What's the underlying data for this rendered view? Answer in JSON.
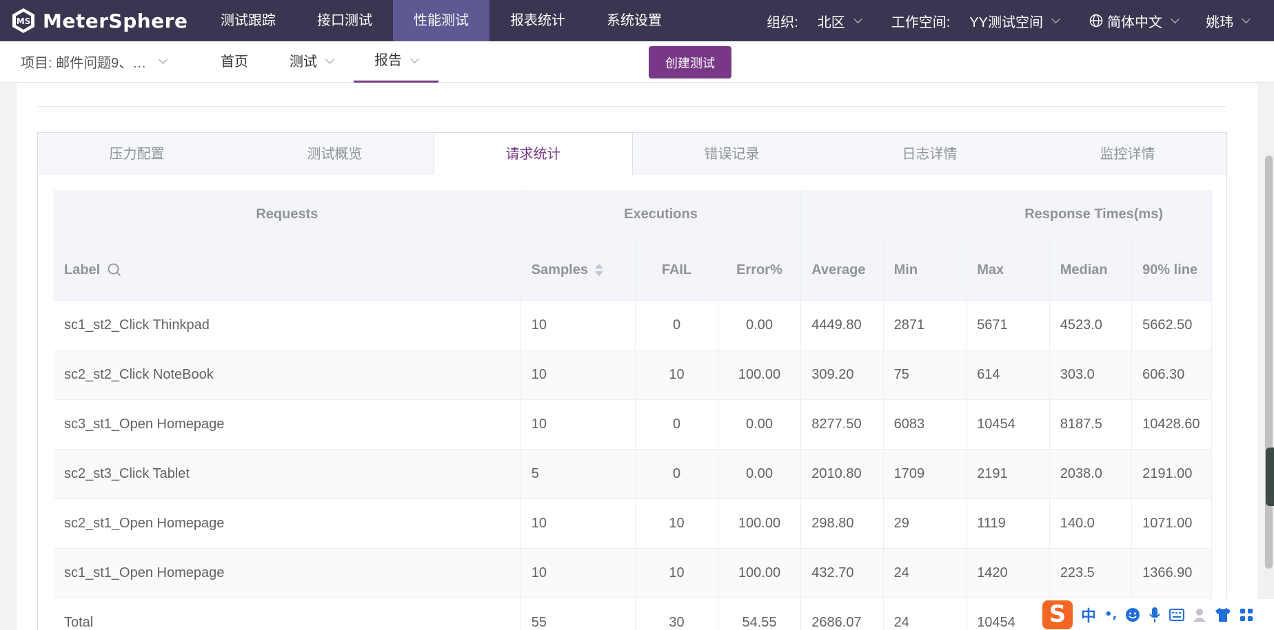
{
  "app": {
    "logo_text": "MeterSphere"
  },
  "topnav": {
    "items": [
      {
        "label": "测试跟踪"
      },
      {
        "label": "接口测试"
      },
      {
        "label": "性能测试"
      },
      {
        "label": "报表统计"
      },
      {
        "label": "系统设置"
      }
    ],
    "active_index": 2,
    "org_label": "组织:",
    "org_value": "北区",
    "workspace_label": "工作空间:",
    "workspace_value": "YY测试空间",
    "language": "简体中文",
    "user": "姚玮"
  },
  "subnav": {
    "project": "项目: 邮件问题9、…",
    "items": [
      {
        "label": "首页"
      },
      {
        "label": "测试"
      },
      {
        "label": "报告"
      }
    ],
    "active_index": 2,
    "create_button": "创建测试"
  },
  "tabs": [
    {
      "label": "压力配置"
    },
    {
      "label": "测试概览"
    },
    {
      "label": "请求统计"
    },
    {
      "label": "错误记录"
    },
    {
      "label": "日志详情"
    },
    {
      "label": "监控详情"
    }
  ],
  "active_tab": 2,
  "table": {
    "groups": {
      "requests": "Requests",
      "executions": "Executions",
      "response_times": "Response Times(ms)"
    },
    "columns": [
      "Label",
      "Samples",
      "FAIL",
      "Error%",
      "Average",
      "Min",
      "Max",
      "Median",
      "90% line"
    ],
    "rows": [
      [
        "sc1_st2_Click Thinkpad",
        "10",
        "0",
        "0.00",
        "4449.80",
        "2871",
        "5671",
        "4523.0",
        "5662.50"
      ],
      [
        "sc2_st2_Click NoteBook",
        "10",
        "10",
        "100.00",
        "309.20",
        "75",
        "614",
        "303.0",
        "606.30"
      ],
      [
        "sc3_st1_Open Homepage",
        "10",
        "0",
        "0.00",
        "8277.50",
        "6083",
        "10454",
        "8187.5",
        "10428.60"
      ],
      [
        "sc2_st3_Click Tablet",
        "5",
        "0",
        "0.00",
        "2010.80",
        "1709",
        "2191",
        "2038.0",
        "2191.00"
      ],
      [
        "sc2_st1_Open Homepage",
        "10",
        "10",
        "100.00",
        "298.80",
        "29",
        "1119",
        "140.0",
        "1071.00"
      ],
      [
        "sc1_st1_Open Homepage",
        "10",
        "10",
        "100.00",
        "432.70",
        "24",
        "1420",
        "223.5",
        "1366.90"
      ],
      [
        "Total",
        "55",
        "30",
        "54.55",
        "2686.07",
        "24",
        "10454",
        "",
        ""
      ]
    ]
  },
  "ime": {
    "lang_char": "中",
    "punct": "•,"
  },
  "colors": {
    "topbar": "#3a3550",
    "nav_active": "#5d5a93",
    "accent": "#783887",
    "header_bg": "#f4f5fa"
  }
}
